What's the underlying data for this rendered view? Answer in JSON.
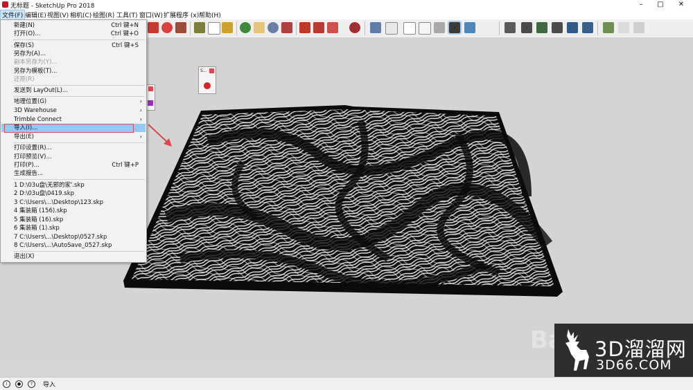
{
  "window": {
    "title": "无标题 - SketchUp Pro 2018",
    "minimize_glyph": "–",
    "maximize_glyph": "□",
    "close_glyph": "✕"
  },
  "menubar": {
    "items": [
      {
        "label": "文件(F)"
      },
      {
        "label": "编辑(E)"
      },
      {
        "label": "视图(V)"
      },
      {
        "label": "相机(C)"
      },
      {
        "label": "绘图(R)"
      },
      {
        "label": "工具(T)"
      },
      {
        "label": "窗口(W)"
      },
      {
        "label": "扩展程序 (x)"
      },
      {
        "label": "帮助(H)"
      }
    ]
  },
  "file_menu": {
    "items": [
      {
        "label": "新建(N)",
        "shortcut": "Ctrl 键+N"
      },
      {
        "label": "打开(O)...",
        "shortcut": "Ctrl 键+O"
      },
      {
        "label": "保存(S)",
        "shortcut": "Ctrl 键+S"
      },
      {
        "label": "另存为(A)..."
      },
      {
        "label": "副本另存为(Y)...",
        "disabled": true
      },
      {
        "label": "另存为模板(T)..."
      },
      {
        "label": "还原(R)",
        "disabled": true
      },
      {
        "label": "发送到 LayOut(L)..."
      },
      {
        "label": "地理位置(G)",
        "submenu": "›"
      },
      {
        "label": "3D Warehouse",
        "submenu": "›"
      },
      {
        "label": "Trimble Connect",
        "submenu": "›"
      },
      {
        "label": "导入(I)...",
        "highlighted": true
      },
      {
        "label": "导出(E)",
        "submenu": "›"
      },
      {
        "label": "打印设置(R)..."
      },
      {
        "label": "打印预览(V)..."
      },
      {
        "label": "打印(P)...",
        "shortcut": "Ctrl 键+P"
      },
      {
        "label": "生成报告..."
      },
      {
        "label": "1 D:\\03u盘\\无邪的家'.skp"
      },
      {
        "label": "2 D:\\03u盘\\0419.skp"
      },
      {
        "label": "3 C:\\Users\\...\\Desktop\\123.skp"
      },
      {
        "label": "4 集装箱 (156).skp"
      },
      {
        "label": "5 集装箱 (16).skp"
      },
      {
        "label": "6 集装箱 (1).skp"
      },
      {
        "label": "7 C:\\Users\\...\\Desktop\\0527.skp"
      },
      {
        "label": "8 C:\\Users\\...\\AutoSave_0527.skp"
      },
      {
        "label": "退出(X)"
      }
    ]
  },
  "floating_panel": {
    "title": "S..."
  },
  "statusbar": {
    "text": "导入",
    "info_glyph": "i",
    "user_glyph": "●",
    "help_glyph": "?"
  },
  "watermark": {
    "line1": "3D溜溜网",
    "line2": "3D66.COM",
    "baidu": "Ba"
  },
  "colors": {
    "accent_highlight": "#91c9f7",
    "red_box": "#e0474c",
    "watermark_bg": "#2e2e2e",
    "viewport_bg": "#d4d4d4"
  }
}
